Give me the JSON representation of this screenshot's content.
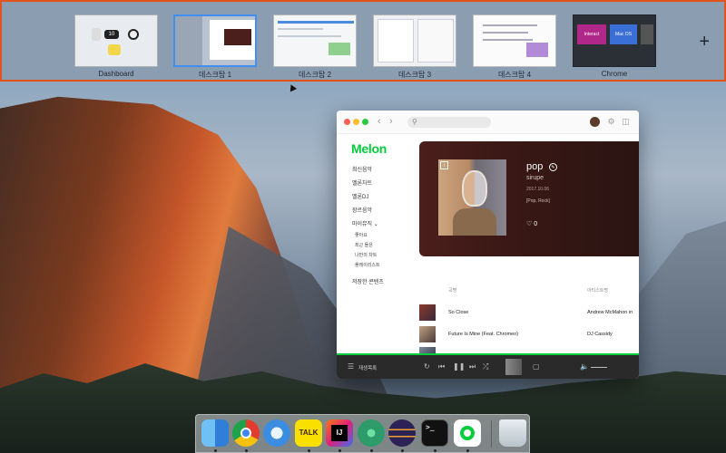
{
  "mission_control": {
    "spaces": [
      {
        "label": "Dashboard",
        "dash_clock": "10"
      },
      {
        "label": "데스크탑 1"
      },
      {
        "label": "데스크탑 2"
      },
      {
        "label": "데스크탑 3"
      },
      {
        "label": "데스크탑 4"
      },
      {
        "label": "Chrome",
        "tile_1": "Interact",
        "tile_2": "Mac OS"
      }
    ],
    "add_label": "+"
  },
  "melon": {
    "logo": "Melon",
    "sidebar": {
      "items": [
        "최신음악",
        "멜론차트",
        "멜론DJ",
        "장르음악",
        "마이뮤직 ⌄"
      ],
      "sub_items": [
        "좋아요",
        "최근 들은",
        "나만의 차트",
        "플레이리스트"
      ],
      "footer_item": "저장한 콘텐츠"
    },
    "album": {
      "title": "pop",
      "artist": "sirupe",
      "date": "2017.10.06",
      "genre": "[Pop, Rock]",
      "likes": "♡ 0"
    },
    "table": {
      "col_title": "곡명",
      "col_artist": "아티스트명",
      "tracks": [
        {
          "title": "So Close",
          "artist": "Andrew McMahon in"
        },
        {
          "title": "Future Is Mine (Feat. Chromeo)",
          "artist": "DJ Cassidy"
        }
      ]
    },
    "player": {
      "playlist_label": "재생목록"
    }
  },
  "colors": {
    "mission_border": "#e2531b",
    "melon_green": "#00cd3c",
    "selected_space": "#3f8ef0"
  },
  "dock": {
    "kakao_label": "TALK",
    "intellij_label": "IJ",
    "terminal_label": ">_",
    "apps": [
      "finder-icon",
      "chrome-icon",
      "safari-icon",
      "kakaotalk-icon",
      "intellij-icon",
      "atom-icon",
      "eclipse-icon",
      "terminal-icon",
      "melon-icon",
      "trash-icon"
    ]
  }
}
